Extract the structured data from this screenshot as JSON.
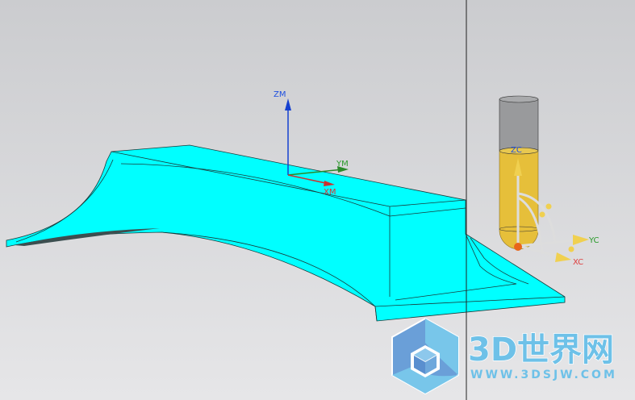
{
  "viewport": {
    "background_top": "#cbcccf",
    "background_bottom": "#e6e6e8",
    "part_color": "#00ffff"
  },
  "model_csys": {
    "z_label": "ZM",
    "y_label": "YM",
    "x_label": "XM"
  },
  "work_csys": {
    "z_label": "ZC",
    "y_label": "YC",
    "x_label": "XC"
  },
  "watermark": {
    "title": "3D世界网",
    "url": "WWW.3DSJW.COM"
  }
}
